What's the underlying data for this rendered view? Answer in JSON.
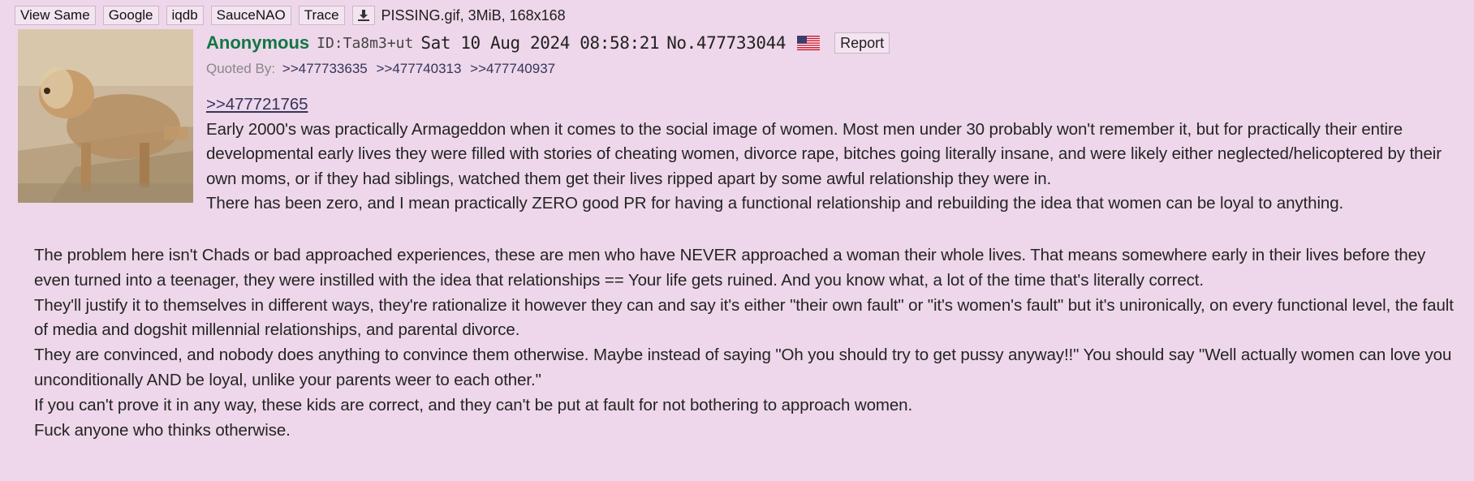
{
  "file": {
    "buttons": [
      "View Same",
      "Google",
      "iqdb",
      "SauceNAO",
      "Trace"
    ],
    "download_icon": "download-icon",
    "info": "PISSING.gif, 3MiB, 168x168"
  },
  "post": {
    "name": "Anonymous",
    "id": "ID:Ta8m3+ut",
    "datetime": "Sat 10 Aug 2024 08:58:21",
    "number": "No.477733044",
    "flag_icon": "us-flag-icon",
    "report_label": "Report",
    "quoted_by_label": "Quoted By:",
    "quoted_by": [
      ">>477733635",
      ">>477740313",
      ">>477740937"
    ],
    "quote_link": ">>477721765",
    "paragraphs_top": [
      "Early 2000's was practically Armageddon when it comes to the social image of women. Most men under 30 probably won't remember it, but for practically their entire developmental early lives they were filled with stories of cheating women, divorce rape, bitches going literally insane, and were likely either neglected/helicoptered by their own moms, or if they had siblings, watched them get their lives ripped apart by some awful relationship they were in.",
      "There has been zero, and I mean practically ZERO good PR for having a functional relationship and rebuilding the idea that women can be loyal to anything."
    ],
    "paragraphs_bottom": [
      "The problem here isn't Chads or bad approached experiences, these are men who have NEVER approached a woman their whole lives. That means somewhere early in their lives before they even turned into a teenager, they were instilled with the idea that relationships == Your life gets ruined. And you know what, a lot of the time that's literally correct.",
      "They'll justify it to themselves in different ways, they're rationalize it however they can and say it's either \"their own fault\" or \"it's women's fault\" but it's unironically, on every functional level, the fault of media and dogshit millennial relationships, and parental divorce.",
      "They are convinced, and nobody does anything to convince them otherwise. Maybe instead of saying \"Oh you should try to get pussy anyway!!\" You should say \"Well actually women can love you unconditionally AND be loyal, unlike your parents weer to each other.\"",
      "If you can't prove it in any way, these kids are correct, and they can't be put at fault for not bothering to approach women.",
      "Fuck anyone who thinks otherwise."
    ]
  },
  "colors": {
    "background": "#eed7ea",
    "name": "#117743",
    "quotelink": "#34345c"
  }
}
